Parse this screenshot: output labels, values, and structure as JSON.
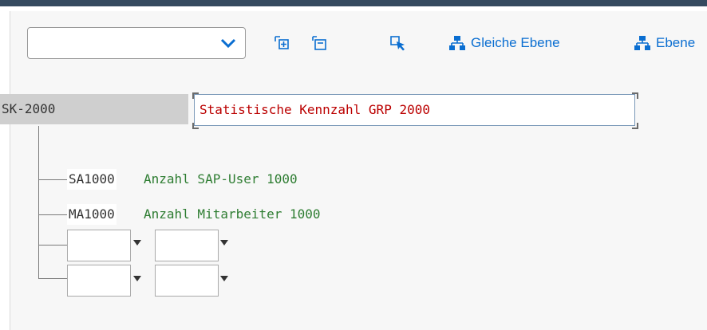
{
  "toolbar": {
    "combo_value": "",
    "buttons": [
      {
        "icon": "expand-subtree-icon",
        "label": ""
      },
      {
        "icon": "collapse-subtree-icon",
        "label": ""
      },
      {
        "icon": "select-cursor-icon",
        "label": ""
      },
      {
        "icon": "hierarchy-icon",
        "label": "Gleiche Ebene"
      },
      {
        "icon": "hierarchy-icon",
        "label": "Ebene"
      }
    ]
  },
  "tree": {
    "root": {
      "code": "SK-2000",
      "description": "Statistische Kennzahl GRP 2000"
    },
    "children": [
      {
        "code": "SA1000",
        "description": "Anzahl SAP-User 1000"
      },
      {
        "code": "MA1000",
        "description": "Anzahl Mitarbeiter 1000"
      }
    ],
    "empty_rows": [
      {
        "first": "",
        "second": ""
      },
      {
        "first": "",
        "second": ""
      }
    ]
  },
  "colors": {
    "accent": "#0a6ed1",
    "root_text": "#bb0000",
    "child_text": "#2e7d32",
    "top_bar": "#354a5f"
  }
}
